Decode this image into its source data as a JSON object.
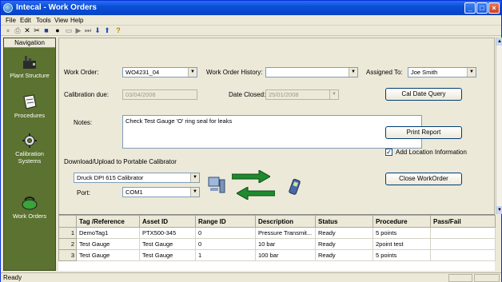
{
  "window": {
    "title": "Intecal - Work Orders"
  },
  "menu": [
    "File",
    "Edit",
    "Tools",
    "View",
    "Help"
  ],
  "toolbar_icons": [
    "new-icon",
    "print-icon",
    "delete-icon",
    "cut-icon",
    "save-icon",
    "pin-icon",
    "window-icon",
    "play-icon",
    "bar-icon",
    "down-arrow-icon",
    "up-arrow-icon",
    "help-icon"
  ],
  "navigation": {
    "header": "Navigation",
    "items": [
      {
        "label": "Plant Structure",
        "icon": "plant-structure-icon"
      },
      {
        "label": "Procedures",
        "icon": "procedures-icon"
      },
      {
        "label": "Calibration Systems",
        "icon": "calibration-systems-icon"
      },
      {
        "label": "Work Orders",
        "icon": "work-orders-icon"
      }
    ]
  },
  "form": {
    "work_order_label": "Work Order:",
    "work_order_value": "WO4231_04",
    "history_label": "Work Order History:",
    "history_value": "",
    "assigned_label": "Assigned To:",
    "assigned_value": "Joe Smith",
    "calibration_due_label": "Calibration due:",
    "calibration_due_value": "03/04/2008",
    "date_closed_label": "Date Closed:",
    "date_closed_value": "25/01/2008",
    "cal_date_query": "Cal Date Query",
    "notes_label": "Notes:",
    "notes_value": "Check Test Gauge 'O' ring seal for leaks",
    "print_report": "Print Report",
    "add_location_label": "Add Location Information",
    "add_location_checked": true,
    "download_label": "Download/Upload to Portable Calibrator",
    "calibrator_value": "Druck DPI 615 Calibrator",
    "port_label": "Port:",
    "port_value": "COM1",
    "close_workorder": "Close WorkOrder"
  },
  "table": {
    "columns": [
      "",
      "Tag /Reference",
      "Asset ID",
      "Range ID",
      "Description",
      "Status",
      "Procedure",
      "Pass/Fail"
    ],
    "rows": [
      [
        "1",
        "DemoTag1",
        "PTX500-345",
        "0",
        "Pressure Transmit...",
        "Ready",
        "5 points",
        ""
      ],
      [
        "2",
        "Test Gauge",
        "Test Gauge",
        "0",
        "10 bar",
        "Ready",
        "2point test",
        ""
      ],
      [
        "3",
        "Test Gauge",
        "Test Gauge",
        "1",
        "100 bar",
        "Ready",
        "5 points",
        ""
      ]
    ]
  },
  "status": {
    "text": "Ready"
  },
  "colors": {
    "nav_bg": "#5b7230",
    "titlebar": "#0a4fd8",
    "arrow_green": "#1f8a2e"
  }
}
